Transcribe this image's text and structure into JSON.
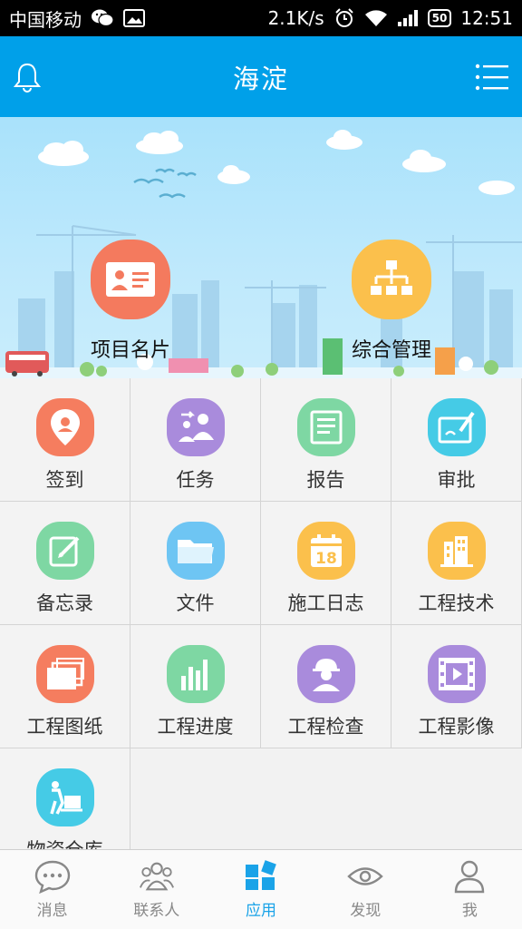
{
  "status_bar": {
    "carrier": "中国移动",
    "speed": "2.1K/s",
    "battery": "50",
    "time": "12:51",
    "icons": [
      "wechat-icon",
      "image-icon",
      "alarm-icon",
      "wifi-icon",
      "signal-icon",
      "battery-icon"
    ]
  },
  "header": {
    "title": "海淀",
    "left_icon": "bell-icon",
    "right_icon": "menu-list-icon",
    "bg_color": "#00a0e9"
  },
  "banner": {
    "quick_actions": [
      {
        "label": "项目名片",
        "icon": "business-card-icon",
        "color": "#f47a5e"
      },
      {
        "label": "综合管理",
        "icon": "org-chart-icon",
        "color": "#fbc04c"
      }
    ]
  },
  "apps": [
    {
      "label": "签到",
      "icon": "location-pin-icon",
      "color": "#f57d5f"
    },
    {
      "label": "任务",
      "icon": "task-people-icon",
      "color": "#a98bdc"
    },
    {
      "label": "报告",
      "icon": "report-document-icon",
      "color": "#7ed7a3"
    },
    {
      "label": "审批",
      "icon": "approval-sign-icon",
      "color": "#45cbe6"
    },
    {
      "label": "备忘录",
      "icon": "memo-edit-icon",
      "color": "#7ed7a3"
    },
    {
      "label": "文件",
      "icon": "folder-icon",
      "color": "#6ec5f3"
    },
    {
      "label": "施工日志",
      "icon": "calendar-icon",
      "color": "#fbc04c"
    },
    {
      "label": "工程技术",
      "icon": "building-icon",
      "color": "#fbc04c"
    },
    {
      "label": "工程图纸",
      "icon": "drawings-stack-icon",
      "color": "#f57d5f"
    },
    {
      "label": "工程进度",
      "icon": "progress-bars-icon",
      "color": "#7ed7a3"
    },
    {
      "label": "工程检查",
      "icon": "inspector-icon",
      "color": "#a98bdc"
    },
    {
      "label": "工程影像",
      "icon": "video-film-icon",
      "color": "#a98bdc"
    },
    {
      "label": "物资仓库",
      "icon": "warehouse-cart-icon",
      "color": "#45cbe6"
    }
  ],
  "bottom_nav": [
    {
      "label": "消息",
      "icon": "chat-bubble-icon",
      "active": false
    },
    {
      "label": "联系人",
      "icon": "contacts-icon",
      "active": false
    },
    {
      "label": "应用",
      "icon": "apps-icon",
      "active": true
    },
    {
      "label": "发现",
      "icon": "eye-icon",
      "active": false
    },
    {
      "label": "我",
      "icon": "person-icon",
      "active": false
    }
  ],
  "colors": {
    "accent": "#1aa3e8",
    "nav_inactive": "#888888"
  }
}
